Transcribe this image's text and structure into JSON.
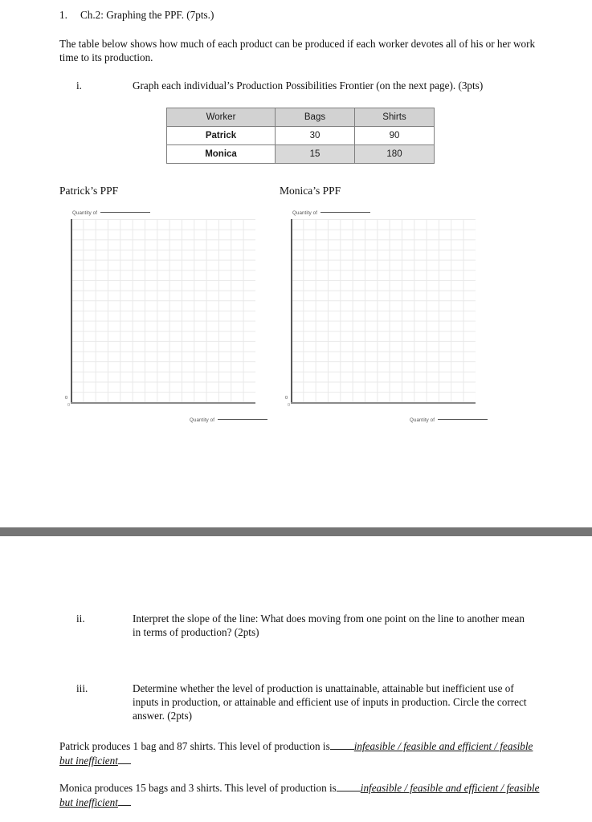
{
  "question": {
    "number": "1.",
    "heading": "Ch.2: Graphing the PPF. (7pts.)",
    "intro": "The table below shows how much of each product can be produced if each worker devotes all of his or her work time to its production."
  },
  "sub_items": {
    "i": {
      "marker": "i.",
      "text": "Graph each individual’s Production Possibilities Frontier (on the next page). (3pts)"
    },
    "ii": {
      "marker": "ii.",
      "text": "Interpret the slope of the line: What does moving from one point on the line to another mean in terms of production? (2pts)"
    },
    "iii": {
      "marker": "iii.",
      "text": "Determine whether the level of production is unattainable, attainable but inefficient use of inputs in production, or attainable and efficient use of inputs in production. Circle the correct answer. (2pts)"
    }
  },
  "table": {
    "headers": [
      "Worker",
      "Bags",
      "Shirts"
    ],
    "rows": [
      {
        "worker": "Patrick",
        "bags": "30",
        "shirts": "90"
      },
      {
        "worker": "Monica",
        "bags": "15",
        "shirts": "180"
      }
    ]
  },
  "graphs": [
    {
      "title": "Patrick’s PPF",
      "y_axis_label": "Quantity of",
      "x_axis_label": "Quantity of",
      "origin_label": "0",
      "origin_label_2": "0"
    },
    {
      "title": "Monica’s PPF",
      "y_axis_label": "Quantity of",
      "x_axis_label": "Quantity of",
      "origin_label": "0",
      "origin_label_2": "0"
    }
  ],
  "answers": {
    "patrick": {
      "prompt": "Patrick produces 1 bag and 87 shirts. This level of production is",
      "options": "infeasible / feasible and efficient / feasible but inefficient"
    },
    "monica": {
      "prompt": "Monica produces 15 bags and 3 shirts. This level of production is",
      "options": "infeasible / feasible and efficient / feasible but inefficient"
    }
  },
  "colors": {
    "table_header_fill": "#d2d2d2",
    "table_shaded_fill": "#d9d9d9",
    "table_border": "#7f7f7f",
    "grid_line": "#e9e9e9",
    "axis": "#595959",
    "page_break_bar": "#757575"
  }
}
